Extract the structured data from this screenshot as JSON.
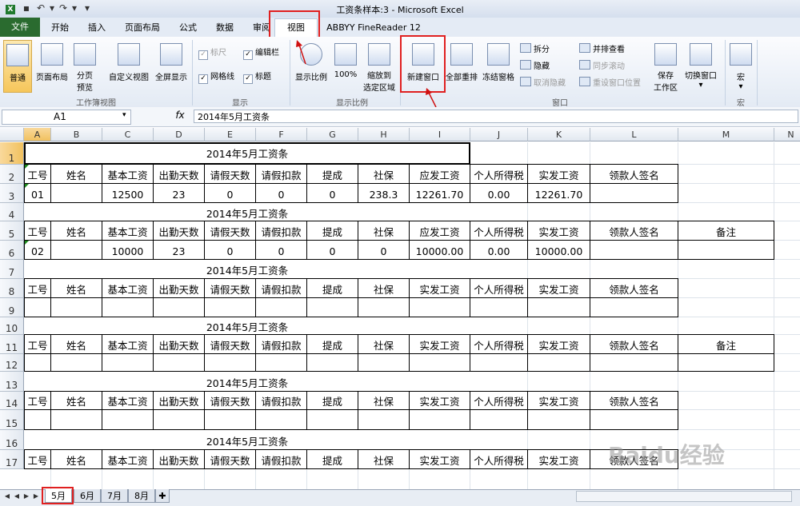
{
  "window": {
    "title": "工资条样本:3 - Microsoft Excel"
  },
  "tabs": [
    {
      "label": "文件"
    },
    {
      "label": "开始"
    },
    {
      "label": "插入"
    },
    {
      "label": "页面布局"
    },
    {
      "label": "公式"
    },
    {
      "label": "数据"
    },
    {
      "label": "审阅"
    },
    {
      "label": "视图"
    },
    {
      "label": "ABBYY FineReader 12"
    }
  ],
  "ribbon": {
    "workbook_views": {
      "label": "工作簿视图",
      "normal": "普通",
      "page_layout": "页面布局",
      "page_break_1": "分页",
      "page_break_2": "预览",
      "custom_views": "自定义视图",
      "full_screen": "全屏显示"
    },
    "show": {
      "label": "显示",
      "ruler": "标尺",
      "formula_bar": "编辑栏",
      "gridlines": "网格线",
      "headings": "标题"
    },
    "zoom": {
      "label": "显示比例",
      "zoom": "显示比例",
      "zoom100": "100%",
      "zoom_sel_1": "缩放到",
      "zoom_sel_2": "选定区域"
    },
    "window": {
      "label": "窗口",
      "new_window": "新建窗口",
      "arrange_all": "全部重排",
      "freeze": "冻结窗格",
      "split": "拆分",
      "hide": "隐藏",
      "unhide": "取消隐藏",
      "side_by_side": "并排查看",
      "sync_scroll": "同步滚动",
      "reset_pos": "重设窗口位置",
      "save_ws_1": "保存",
      "save_ws_2": "工作区",
      "switch": "切换窗口"
    },
    "macros": {
      "label": "宏",
      "macros": "宏"
    }
  },
  "formula_bar": {
    "name_box": "A1",
    "fx": "fx",
    "content": "2014年5月工资条"
  },
  "columns": [
    "A",
    "B",
    "C",
    "D",
    "E",
    "F",
    "G",
    "H",
    "I",
    "J",
    "K",
    "L",
    "M",
    "N"
  ],
  "rows": [
    "1",
    "2",
    "3",
    "4",
    "5",
    "6",
    "7",
    "8",
    "9",
    "10",
    "11",
    "12",
    "13",
    "14",
    "15",
    "16",
    "17"
  ],
  "sheet": {
    "title": "2014年5月工资条",
    "headers1": [
      "工号",
      "姓名",
      "基本工资",
      "出勤天数",
      "请假天数",
      "请假扣款",
      "提成",
      "社保",
      "应发工资",
      "个人所得税",
      "实发工资",
      "领款人签名"
    ],
    "headers2": [
      "工号",
      "姓名",
      "基本工资",
      "出勤天数",
      "请假天数",
      "请假扣款",
      "提成",
      "社保",
      "实发工资",
      "个人所得税",
      "实发工资",
      "领款人签名"
    ],
    "note": "备注",
    "record1": [
      "01",
      "",
      "12500",
      "23",
      "0",
      "0",
      "0",
      "238.3",
      "12261.70",
      "0.00",
      "12261.70",
      ""
    ],
    "record2": [
      "02",
      "",
      "10000",
      "23",
      "0",
      "0",
      "0",
      "0",
      "10000.00",
      "0.00",
      "10000.00",
      ""
    ]
  },
  "sheet_tabs": [
    "5月",
    "6月",
    "7月",
    "8月"
  ],
  "watermark": "Baidu经验"
}
